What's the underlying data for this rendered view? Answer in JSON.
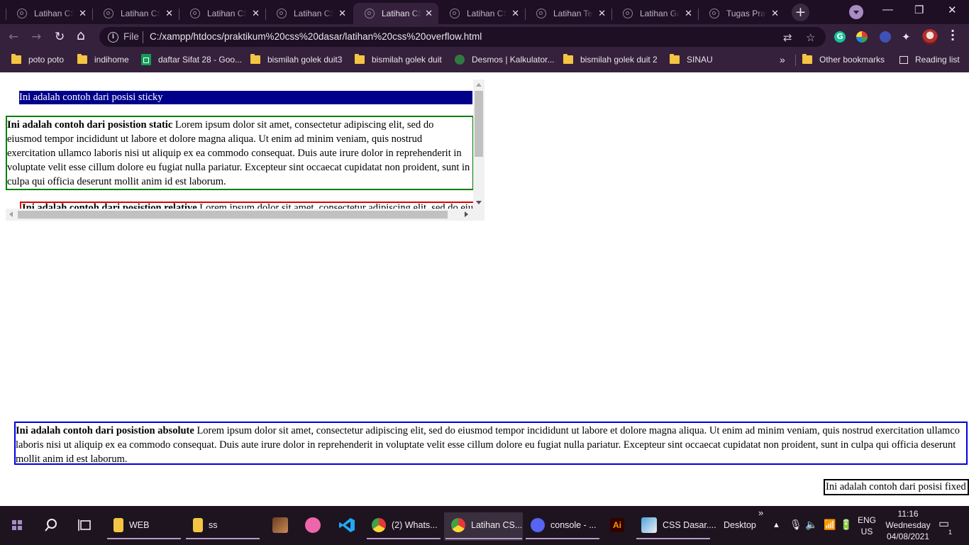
{
  "browser": {
    "tabs": [
      {
        "label": "Latihan CSS",
        "active": false
      },
      {
        "label": "Latihan CSS",
        "active": false
      },
      {
        "label": "Latihan CSS",
        "active": false
      },
      {
        "label": "Latihan CSS",
        "active": false
      },
      {
        "label": "Latihan CSS",
        "active": true
      },
      {
        "label": "Latihan CSS",
        "active": false
      },
      {
        "label": "Latihan Tes",
        "active": false
      },
      {
        "label": "Latihan Ga",
        "active": false
      },
      {
        "label": "Tugas Prak",
        "active": false
      }
    ],
    "new_tab_label": "+",
    "window_controls": {
      "minimize": "—",
      "restore": "❐",
      "close": "✕"
    },
    "address": {
      "scheme_label": "File",
      "url": "C:/xampp/htdocs/praktikum%20css%20dasar/latihan%20css%20overflow.html"
    },
    "bookmarks": [
      {
        "label": "poto poto",
        "icon": "folder-icon"
      },
      {
        "label": "indihome",
        "icon": "folder-icon"
      },
      {
        "label": "daftar Sifat 28 - Goo...",
        "icon": "sheets-icon"
      },
      {
        "label": "bismilah golek duit3",
        "icon": "folder-icon"
      },
      {
        "label": "bismilah golek duit",
        "icon": "folder-icon"
      },
      {
        "label": "Desmos | Kalkulator...",
        "icon": "desmos-icon"
      },
      {
        "label": "bismilah golek duit 2",
        "icon": "folder-icon"
      },
      {
        "label": "SINAU",
        "icon": "folder-icon"
      }
    ],
    "bookmarks_overflow": "»",
    "other_bookmarks": "Other bookmarks",
    "reading_list": "Reading list"
  },
  "page": {
    "sticky_text": "Ini adalah contoh dari posisi sticky",
    "static": {
      "title": "Ini adalah contoh dari posistion static",
      "body": " Lorem ipsum dolor sit amet, consectetur adipiscing elit, sed do eiusmod tempor incididunt ut labore et dolore magna aliqua. Ut enim ad minim veniam, quis nostrud exercitation ullamco laboris nisi ut aliquip ex ea commodo consequat. Duis aute irure dolor in reprehenderit in voluptate velit esse cillum dolore eu fugiat nulla pariatur. Excepteur sint occaecat cupidatat non proident, sunt in culpa qui officia deserunt mollit anim id est laborum."
    },
    "relative": {
      "title": "Ini adalah contoh dari posistion relative",
      "body": " Lorem ipsum dolor sit amet, consectetur adipiscing elit, sed do eiusmod tempor"
    },
    "absolute": {
      "title": "Ini adalah contoh dari posistion absolute",
      "body": " Lorem ipsum dolor sit amet, consectetur adipiscing elit, sed do eiusmod tempor incididunt ut labore et dolore magna aliqua. Ut enim ad minim veniam, quis nostrud exercitation ullamco laboris nisi ut aliquip ex ea commodo consequat. Duis aute irure dolor in reprehenderit in voluptate velit esse cillum dolore eu fugiat nulla pariatur. Excepteur sint occaecat cupidatat non proident, sunt in culpa qui officia deserunt mollit anim id est laborum."
    },
    "fixed_text": "Ini adalah contoh dari posisi fixed"
  },
  "taskbar": {
    "items": [
      {
        "label": "WEB",
        "icon": "folder-icon"
      },
      {
        "label": "ss",
        "icon": "folder-icon"
      },
      {
        "label": "",
        "icon": "game-icon"
      },
      {
        "label": "",
        "icon": "osu-icon"
      },
      {
        "label": "",
        "icon": "vscode-icon"
      },
      {
        "label": "(2) Whats...",
        "icon": "chrome-icon"
      },
      {
        "label": "Latihan CS...",
        "icon": "chrome-icon"
      },
      {
        "label": "console - ...",
        "icon": "discord-icon"
      },
      {
        "label": "",
        "icon": "illustrator-icon"
      },
      {
        "label": "CSS Dasar....",
        "icon": "document-icon"
      }
    ],
    "desktop_label": "Desktop",
    "desktop_overflow": "»",
    "lang_top": "ENG",
    "lang_bottom": "US",
    "time": "11:16",
    "day": "Wednesday",
    "date": "04/08/2021",
    "notification_count": "1"
  },
  "colors": {
    "tabstrip": "#1e0f24",
    "toolbar": "#35213b",
    "sticky_bg": "#00008b",
    "static_border": "#008000",
    "relative_border": "#e00000",
    "absolute_border": "#0000e0",
    "taskbar": "#1d1420"
  }
}
